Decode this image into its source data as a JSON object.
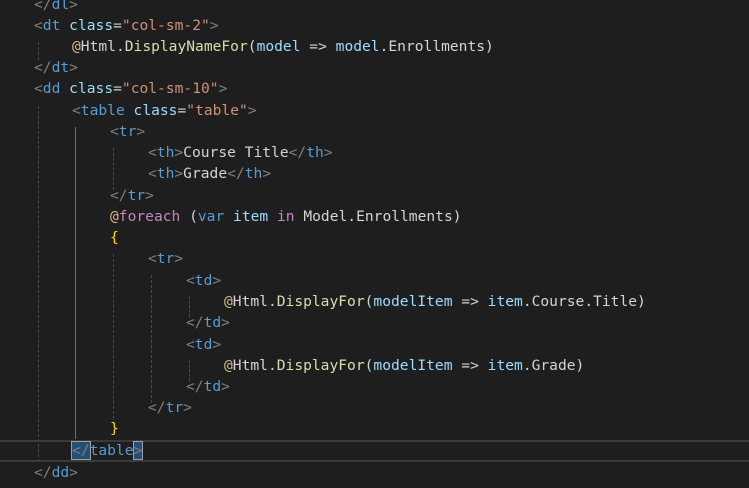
{
  "editor": {
    "lines": [
      [
        "</dl>"
      ],
      [
        "<dt class=\"col-sm-2\">"
      ],
      [
        "@Html.DisplayNameFor(model => model.Enrollments)"
      ],
      [
        "</dt>"
      ],
      [
        "<dd class=\"col-sm-10\">"
      ],
      [
        "<table class=\"table\">"
      ],
      [
        "<tr>"
      ],
      [
        "<th>Course Title</th>"
      ],
      [
        "<th>Grade</th>"
      ],
      [
        "</tr>"
      ],
      [
        "@foreach (var item in Model.Enrollments)"
      ],
      [
        "{"
      ],
      [
        "<tr>"
      ],
      [
        "<td>"
      ],
      [
        "@Html.DisplayFor(modelItem => item.Course.Title)"
      ],
      [
        "</td>"
      ],
      [
        "<td>"
      ],
      [
        "@Html.DisplayFor(modelItem => item.Grade)"
      ],
      [
        "</td>"
      ],
      [
        "</tr>"
      ],
      [
        "}"
      ],
      [
        "</table>"
      ],
      [
        "</dd>"
      ]
    ],
    "tokens": {
      "l0": {
        "a": "</",
        "b": "dl",
        "c": ">"
      },
      "l1": {
        "a": "<",
        "b": "dt",
        "c": " ",
        "d": "class",
        "e": "=",
        "f": "\"col-sm-2\"",
        "g": ">"
      },
      "l2": {
        "a": "@",
        "b": "Html",
        "c": ".",
        "d": "DisplayNameFor",
        "e": "(",
        "f": "model",
        "g": " => ",
        "h": "model",
        "i": ".",
        "j": "Enrollments",
        "k": ")"
      },
      "l3": {
        "a": "</",
        "b": "dt",
        "c": ">"
      },
      "l4": {
        "a": "<",
        "b": "dd",
        "c": " ",
        "d": "class",
        "e": "=",
        "f": "\"col-sm-10\"",
        "g": ">"
      },
      "l5": {
        "a": "<",
        "b": "table",
        "c": " ",
        "d": "class",
        "e": "=",
        "f": "\"table\"",
        "g": ">"
      },
      "l6": {
        "a": "<",
        "b": "tr",
        "c": ">"
      },
      "l7": {
        "a": "<",
        "b": "th",
        "c": ">",
        "d": "Course Title",
        "e": "</",
        "f": "th",
        "g": ">"
      },
      "l8": {
        "a": "<",
        "b": "th",
        "c": ">",
        "d": "Grade",
        "e": "</",
        "f": "th",
        "g": ">"
      },
      "l9": {
        "a": "</",
        "b": "tr",
        "c": ">"
      },
      "l10": {
        "a": "@",
        "b": "foreach",
        "c": " (",
        "d": "var",
        "e": " ",
        "f": "item",
        "g": " ",
        "h": "in",
        "i": " Model.Enrollments)"
      },
      "l11": {
        "a": "{"
      },
      "l12": {
        "a": "<",
        "b": "tr",
        "c": ">"
      },
      "l13": {
        "a": "<",
        "b": "td",
        "c": ">"
      },
      "l14": {
        "a": "@",
        "b": "Html",
        "c": ".",
        "d": "DisplayFor",
        "e": "(",
        "f": "modelItem",
        "g": " => ",
        "h": "item",
        "i": ".Course.Title)"
      },
      "l15": {
        "a": "</",
        "b": "td",
        "c": ">"
      },
      "l16": {
        "a": "<",
        "b": "td",
        "c": ">"
      },
      "l17": {
        "a": "@",
        "b": "Html",
        "c": ".",
        "d": "DisplayFor",
        "e": "(",
        "f": "modelItem",
        "g": " => ",
        "h": "item",
        "i": ".Grade)"
      },
      "l18": {
        "a": "</",
        "b": "td",
        "c": ">"
      },
      "l19": {
        "a": "</",
        "b": "tr",
        "c": ">"
      },
      "l20": {
        "a": "}"
      },
      "l21": {
        "a": "</",
        "b": "table",
        "c": ">"
      },
      "l22": {
        "a": "</",
        "b": "dd",
        "c": ">"
      }
    }
  },
  "theme": {
    "background": "#1e1e1e",
    "tag_color": "#569cd6",
    "attribute_color": "#9cdcfe",
    "string_color": "#ce9178",
    "function_color": "#dcdcaa",
    "razor_color": "#d7ba7d",
    "control_color": "#c586c0",
    "selection_color": "#264f78"
  }
}
